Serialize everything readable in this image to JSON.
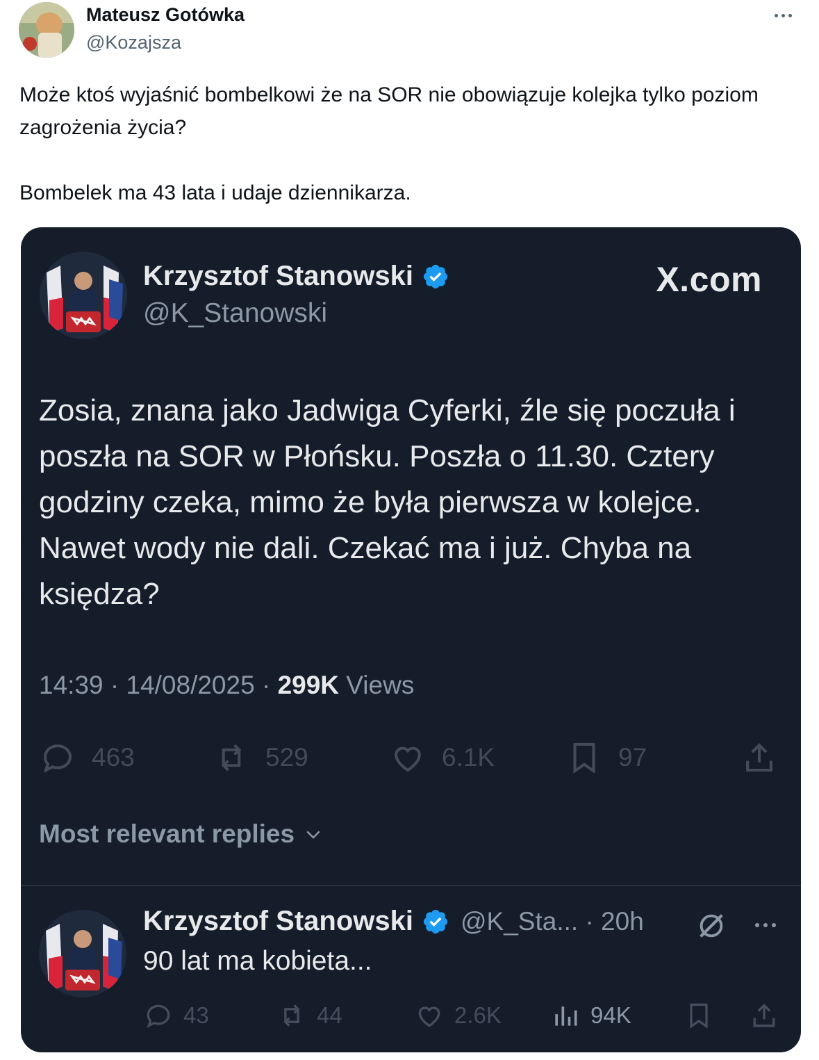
{
  "outer_tweet": {
    "author_name": "Mateusz Gotówka",
    "author_handle": "@Kozajsza",
    "paragraphs": [
      "Może ktoś wyjaśnić bombelkowi że na SOR nie obowiązuje kolejka tylko poziom zagrożenia życia?",
      "Bombelek ma 43 lata i udaje dziennikarza."
    ],
    "more_icon": "more-horizontal-icon"
  },
  "embedded_tweet": {
    "author_name": "Krzysztof Stanowski",
    "author_handle": "@K_Stanowski",
    "verified_icon": "verified-badge-icon",
    "source_label": "X.com",
    "text": "Zosia, znana jako Jadwiga Cyferki, źle się poczuła i poszła na SOR w Płońsku. Poszła o 11.30. Cztery godziny czeka, mimo że była pierwsza w kolejce. Nawet wody nie dali. Czekać ma i już. Chyba na księdza?",
    "meta": {
      "time": "14:39",
      "separator": " · ",
      "date": "14/08/2025",
      "views_count": "299K",
      "views_label": "Views"
    },
    "actions": {
      "replies": "463",
      "reposts": "529",
      "likes": "6.1K",
      "bookmarks": "97"
    },
    "replies_sort_label": "Most relevant replies"
  },
  "reply": {
    "author_name": "Krzysztof Stanowski",
    "author_handle_time": "@K_Sta... · 20h",
    "text": "90 lat ma kobieta...",
    "actions": {
      "replies": "43",
      "reposts": "44",
      "likes": "2.6K",
      "views": "94K"
    }
  },
  "colors": {
    "card_background": "#151d2b",
    "verified_blue": "#1d9bf0",
    "text_light": "#e7e9ea",
    "text_muted": "#8b98a5"
  }
}
